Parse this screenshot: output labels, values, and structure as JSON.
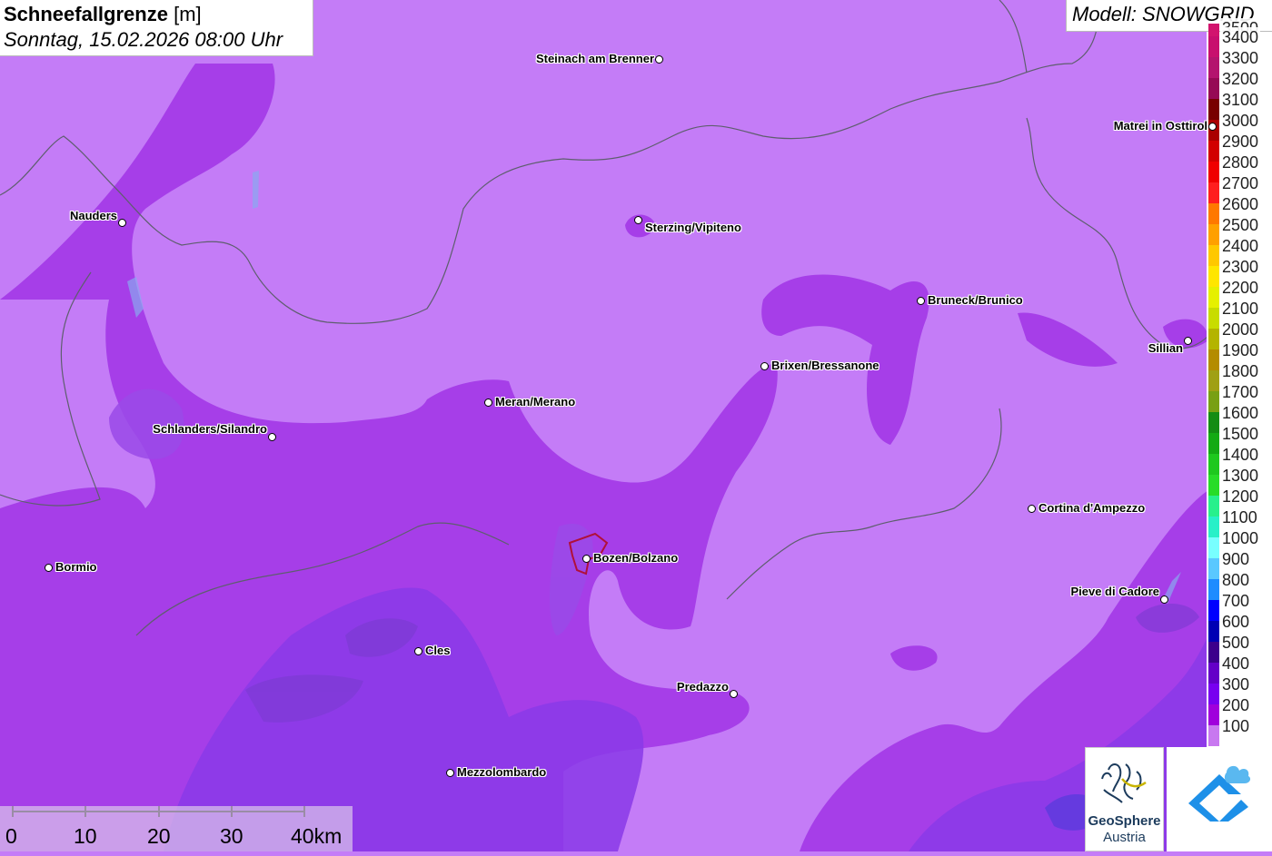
{
  "title": {
    "label": "Schneefallgrenze",
    "unit": "[m]",
    "datetime": "Sonntag, 15.02.2026 08:00 Uhr"
  },
  "model": "Modell: SNOWGRID",
  "legend": {
    "partial_top_label": "3500",
    "entries": [
      {
        "value": "3400",
        "color": "#c80f6e"
      },
      {
        "value": "3300",
        "color": "#b4146e"
      },
      {
        "value": "3200",
        "color": "#960a55"
      },
      {
        "value": "3100",
        "color": "#780000"
      },
      {
        "value": "3000",
        "color": "#aa0000"
      },
      {
        "value": "2900",
        "color": "#d20000"
      },
      {
        "value": "2800",
        "color": "#f00000"
      },
      {
        "value": "2700",
        "color": "#ff1e1e"
      },
      {
        "value": "2600",
        "color": "#ff7800"
      },
      {
        "value": "2500",
        "color": "#ffa000"
      },
      {
        "value": "2400",
        "color": "#ffc800"
      },
      {
        "value": "2300",
        "color": "#ffe600"
      },
      {
        "value": "2200",
        "color": "#e6f000"
      },
      {
        "value": "2100",
        "color": "#c8dc00"
      },
      {
        "value": "2000",
        "color": "#b4b400"
      },
      {
        "value": "1900",
        "color": "#b48c00"
      },
      {
        "value": "1800",
        "color": "#a0a014"
      },
      {
        "value": "1700",
        "color": "#78a014"
      },
      {
        "value": "1600",
        "color": "#148c14"
      },
      {
        "value": "1500",
        "color": "#14aa14"
      },
      {
        "value": "1400",
        "color": "#1ec81e"
      },
      {
        "value": "1300",
        "color": "#28dc28"
      },
      {
        "value": "1200",
        "color": "#28f08c"
      },
      {
        "value": "1100",
        "color": "#28f0c8"
      },
      {
        "value": "1000",
        "color": "#78ffff"
      },
      {
        "value": "900",
        "color": "#5ac8ff"
      },
      {
        "value": "800",
        "color": "#1e8cff"
      },
      {
        "value": "700",
        "color": "#0000ff"
      },
      {
        "value": "600",
        "color": "#0000b4"
      },
      {
        "value": "500",
        "color": "#3c008c"
      },
      {
        "value": "400",
        "color": "#6400c8"
      },
      {
        "value": "300",
        "color": "#7800f0"
      },
      {
        "value": "200",
        "color": "#a000dc"
      },
      {
        "value": "100",
        "color": "#c878f0"
      }
    ]
  },
  "places": [
    {
      "name": "Steinach am Brenner",
      "side": "left"
    },
    {
      "name": "Nauders",
      "side": "left"
    },
    {
      "name": "Sterzing/Vipiteno",
      "side": "right"
    },
    {
      "name": "Bruneck/Brunico",
      "side": "right"
    },
    {
      "name": "Brixen/Bressanone",
      "side": "right"
    },
    {
      "name": "Meran/Merano",
      "side": "right"
    },
    {
      "name": "Schlanders/Silandro",
      "side": "left"
    },
    {
      "name": "Sillian",
      "side": "left"
    },
    {
      "name": "Matrei in Osttirol",
      "side": "left"
    },
    {
      "name": "Cortina d'Ampezzo",
      "side": "right"
    },
    {
      "name": "Bormio",
      "side": "right"
    },
    {
      "name": "Bozen/Bolzano",
      "side": "right"
    },
    {
      "name": "Pieve di Cadore",
      "side": "left"
    },
    {
      "name": "Cles",
      "side": "right"
    },
    {
      "name": "Predazzo",
      "side": "left"
    },
    {
      "name": "Mezzolombardo",
      "side": "right"
    }
  ],
  "scale_bar": {
    "labels": [
      "0",
      "10",
      "20",
      "30",
      "40km"
    ]
  },
  "logos": {
    "geosphere_line1": "GeoSphere",
    "geosphere_line2": "Austria"
  },
  "colors": {
    "background_100": "#c47cf7",
    "band_200": "#a63ee8",
    "band_300": "#8a3ae8",
    "shading": "#7a3ad0"
  }
}
